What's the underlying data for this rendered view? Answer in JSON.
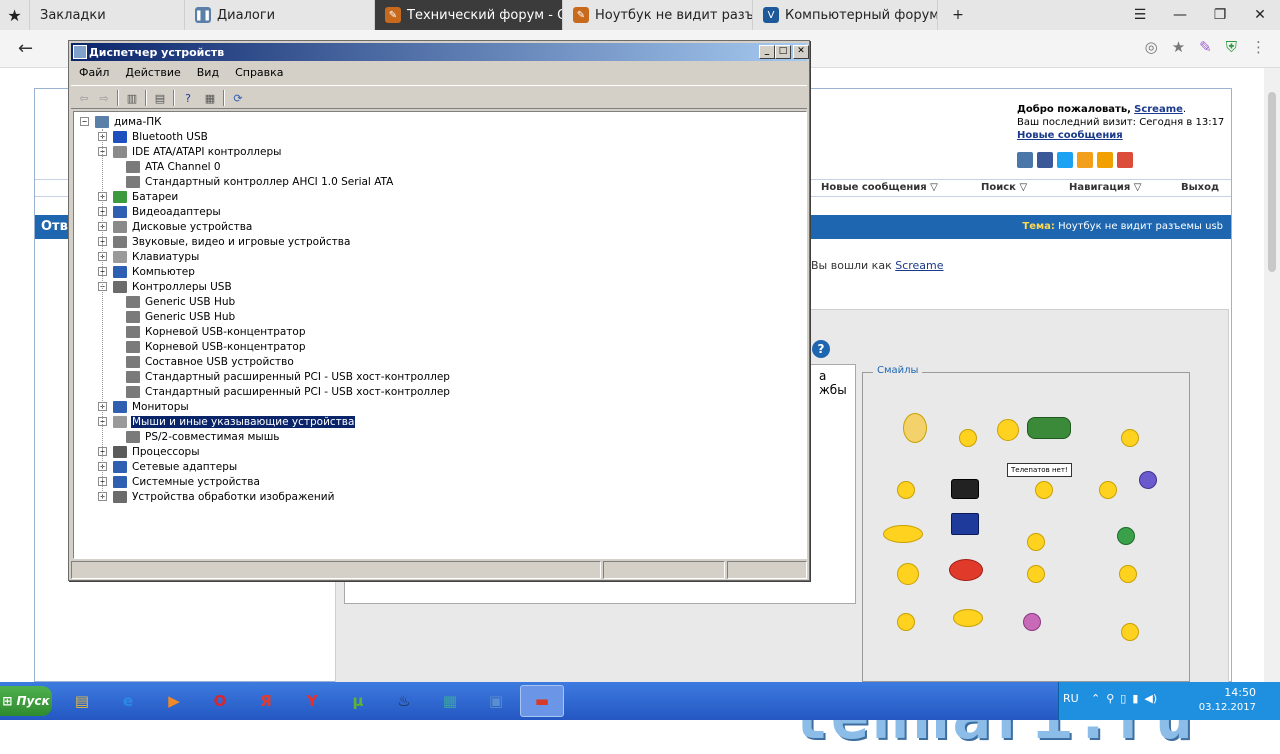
{
  "browser": {
    "tabs": [
      {
        "label": "Закладки",
        "active": false
      },
      {
        "label": "Диалоги",
        "active": false
      },
      {
        "label": "Технический форум - Отв",
        "active": true
      },
      {
        "label": "Ноутбук не видит разъемы",
        "active": false
      },
      {
        "label": "Компьютерный форум",
        "active": false
      }
    ],
    "new_tab": "+",
    "window_controls": {
      "menu": "☰",
      "minimize": "—",
      "restore": "❐",
      "close": "✕"
    },
    "back": "←"
  },
  "forum": {
    "welcome_prefix": "Добро пожаловать,",
    "username": "Screame",
    "last_visit_prefix": "Ваш последний визит: Сегодня в",
    "last_visit_time": "13:17",
    "new_messages_link": "Новые сообщения",
    "nav": {
      "new_messages": "Новые сообщения ▽",
      "search": "Поиск ▽",
      "navigation": "Навигация ▽",
      "logout": "Выход"
    },
    "topic_bar_left": "Отв",
    "topic_label": "Тема:",
    "topic_title": "Ноутбук не видит разъемы usb",
    "logged_in_prefix": "Вы вошли как",
    "logged_in_user": "Screame",
    "textarea_line1": "а",
    "textarea_line2": "жбы",
    "smiles_legend": "Смайлы",
    "telepat_sign": "Телепатов нет!",
    "watermark": "tehnari.ru"
  },
  "device_manager": {
    "title": "Диспетчер устройств",
    "menu": [
      "Файл",
      "Действие",
      "Вид",
      "Справка"
    ],
    "root": "дима-ПК",
    "categories": [
      {
        "label": "Bluetooth USB",
        "expanded": false,
        "color": "#1e4fbf",
        "children": []
      },
      {
        "label": "IDE ATA/ATAPI контроллеры",
        "expanded": true,
        "color": "#8a8a8a",
        "children": [
          "ATA Channel 0",
          "Стандартный контроллер AHCI 1.0 Serial ATA"
        ]
      },
      {
        "label": "Батареи",
        "expanded": false,
        "color": "#3d9a3d",
        "children": []
      },
      {
        "label": "Видеоадаптеры",
        "expanded": false,
        "color": "#2f5fb0",
        "children": []
      },
      {
        "label": "Дисковые устройства",
        "expanded": false,
        "color": "#8a8a8a",
        "children": []
      },
      {
        "label": "Звуковые, видео и игровые устройства",
        "expanded": false,
        "color": "#7a7a7a",
        "children": []
      },
      {
        "label": "Клавиатуры",
        "expanded": false,
        "color": "#9a9a9a",
        "children": []
      },
      {
        "label": "Компьютер",
        "expanded": false,
        "color": "#2f5fb0",
        "children": []
      },
      {
        "label": "Контроллеры USB",
        "expanded": true,
        "color": "#6b6b6b",
        "children": [
          "Generic USB Hub",
          "Generic USB Hub",
          "Корневой USB-концентратор",
          "Корневой USB-концентратор",
          "Составное USB устройство",
          "Стандартный расширенный PCI - USB хост-контроллер",
          "Стандартный расширенный PCI - USB хост-контроллер"
        ]
      },
      {
        "label": "Мониторы",
        "expanded": false,
        "color": "#2f5fb0",
        "children": []
      },
      {
        "label": "Мыши и иные указывающие устройства",
        "expanded": true,
        "selected": true,
        "color": "#9a9a9a",
        "children": [
          "PS/2-совместимая мышь"
        ]
      },
      {
        "label": "Процессоры",
        "expanded": false,
        "color": "#5a5a5a",
        "children": []
      },
      {
        "label": "Сетевые адаптеры",
        "expanded": false,
        "color": "#2f5fb0",
        "children": []
      },
      {
        "label": "Системные устройства",
        "expanded": false,
        "color": "#2f5fb0",
        "children": []
      },
      {
        "label": "Устройства обработки изображений",
        "expanded": false,
        "color": "#6b6b6b",
        "children": []
      }
    ]
  },
  "taskbar": {
    "start_label": "Пуск",
    "apps": [
      {
        "name": "explorer",
        "glyph": "▤",
        "color": "#e8b93a"
      },
      {
        "name": "ie",
        "glyph": "e",
        "color": "#2a8ae6"
      },
      {
        "name": "media",
        "glyph": "▶",
        "color": "#f08a24"
      },
      {
        "name": "opera",
        "glyph": "O",
        "color": "#d8262e"
      },
      {
        "name": "yandex",
        "glyph": "Я",
        "color": "#e23b2e"
      },
      {
        "name": "yandex-browser",
        "glyph": "Y",
        "color": "#e8302a"
      },
      {
        "name": "utorrent",
        "glyph": "µ",
        "color": "#5fb233"
      },
      {
        "name": "steam",
        "glyph": "♨",
        "color": "#1b2838"
      },
      {
        "name": "app-blocks",
        "glyph": "▦",
        "color": "#3aa6a0"
      },
      {
        "name": "network-app",
        "glyph": "▣",
        "color": "#5a8fd0"
      },
      {
        "name": "toolbox",
        "glyph": "▬",
        "color": "#d83a2a"
      }
    ],
    "lang": "RU",
    "time": "14:50",
    "date": "03.12.2017"
  }
}
